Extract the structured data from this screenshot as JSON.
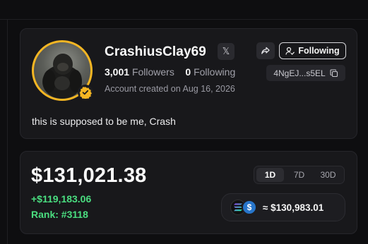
{
  "profile": {
    "username": "CrashiusClay69",
    "followers_count": "3,001",
    "followers_label": "Followers",
    "following_count": "0",
    "following_label": "Following",
    "created": "Account created on Aug 16, 2026",
    "follow_button_label": "Following",
    "wallet_address": "4NgEJ...s5EL",
    "bio": "this is supposed to be me, Crash",
    "x_icon_glyph": "𝕏"
  },
  "portfolio": {
    "balance": "$131,021.38",
    "change": "+$119,183.06",
    "rank": "Rank: #3118",
    "ranges": [
      "1D",
      "7D",
      "30D"
    ],
    "selected_range": "1D",
    "holdings_value": "≈ $130,983.01",
    "usdc_glyph": "$"
  },
  "colors": {
    "accent_gold": "#f5b623",
    "positive_green": "#4ade80",
    "usdc_blue": "#2775ca"
  },
  "icons": [
    "x-logo-icon",
    "share-icon",
    "user-check-icon",
    "copy-icon",
    "verified-badge-icon",
    "solana-icon",
    "usdc-icon"
  ]
}
